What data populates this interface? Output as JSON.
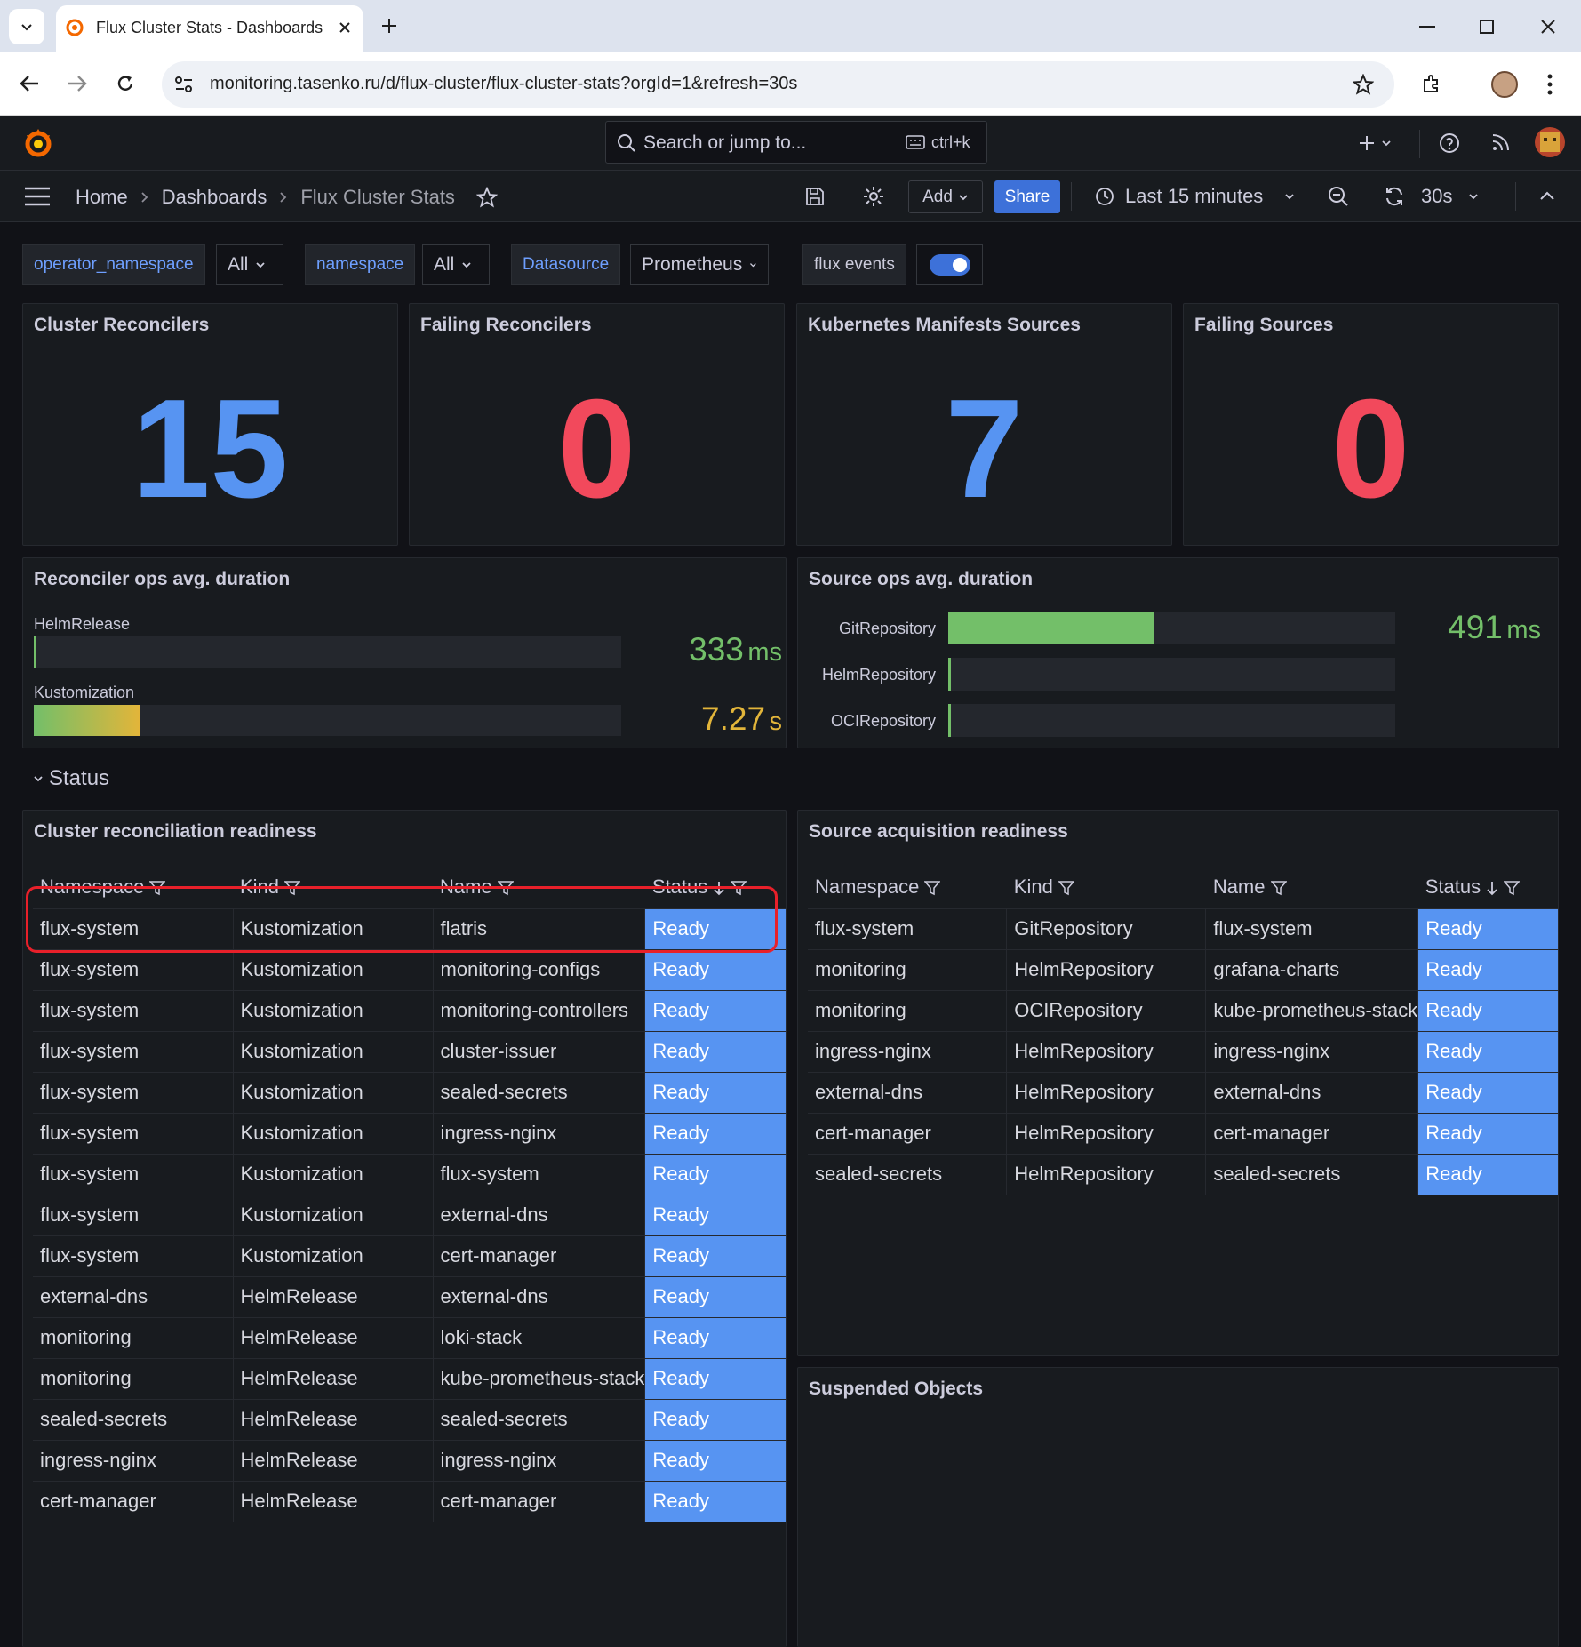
{
  "browser": {
    "tab_title": "Flux Cluster Stats - Dashboards",
    "url": "monitoring.tasenko.ru/d/flux-cluster/flux-cluster-stats?orgId=1&refresh=30s"
  },
  "topbar": {
    "search_placeholder": "Search or jump to...",
    "search_shortcut": "ctrl+k"
  },
  "breadcrumb": {
    "home": "Home",
    "dashboards": "Dashboards",
    "current": "Flux Cluster Stats"
  },
  "toolbar": {
    "add_label": "Add",
    "share_label": "Share",
    "time_range": "Last 15 minutes",
    "refresh_interval": "30s"
  },
  "variables": {
    "operator_namespace": {
      "label": "operator_namespace",
      "value": "All"
    },
    "namespace": {
      "label": "namespace",
      "value": "All"
    },
    "datasource": {
      "label": "Datasource",
      "value": "Prometheus"
    },
    "flux_events": {
      "label": "flux events",
      "enabled": true
    }
  },
  "stats": [
    {
      "title": "Cluster Reconcilers",
      "value": "15",
      "color": "#5794f2"
    },
    {
      "title": "Failing Reconcilers",
      "value": "0",
      "color": "#f2495c"
    },
    {
      "title": "Kubernetes Manifests Sources",
      "value": "7",
      "color": "#5794f2"
    },
    {
      "title": "Failing Sources",
      "value": "0",
      "color": "#f2495c"
    }
  ],
  "reconciler_ops": {
    "title": "Reconciler ops avg. duration",
    "bars": [
      {
        "label": "HelmRelease",
        "value": "333",
        "unit": "ms",
        "fill": 0.004,
        "color": "#73bf69"
      },
      {
        "label": "Kustomization",
        "value": "7.27",
        "unit": "s",
        "fill": 0.18,
        "color": "#e2b53a"
      }
    ]
  },
  "source_ops": {
    "title": "Source ops avg. duration",
    "value": "491",
    "unit": "ms",
    "value_color": "#73bf69",
    "bars": [
      {
        "label": "GitRepository",
        "fill": 0.46
      },
      {
        "label": "HelmRepository",
        "fill": 0.004
      },
      {
        "label": "OCIRepository",
        "fill": 0.004
      }
    ]
  },
  "status_row": {
    "title": "Status"
  },
  "cluster_readiness": {
    "title": "Cluster reconciliation readiness",
    "columns": [
      "Namespace",
      "Kind",
      "Name",
      "Status"
    ],
    "rows": [
      [
        "flux-system",
        "Kustomization",
        "flatris",
        "Ready"
      ],
      [
        "flux-system",
        "Kustomization",
        "monitoring-configs",
        "Ready"
      ],
      [
        "flux-system",
        "Kustomization",
        "monitoring-controllers",
        "Ready"
      ],
      [
        "flux-system",
        "Kustomization",
        "cluster-issuer",
        "Ready"
      ],
      [
        "flux-system",
        "Kustomization",
        "sealed-secrets",
        "Ready"
      ],
      [
        "flux-system",
        "Kustomization",
        "ingress-nginx",
        "Ready"
      ],
      [
        "flux-system",
        "Kustomization",
        "flux-system",
        "Ready"
      ],
      [
        "flux-system",
        "Kustomization",
        "external-dns",
        "Ready"
      ],
      [
        "flux-system",
        "Kustomization",
        "cert-manager",
        "Ready"
      ],
      [
        "external-dns",
        "HelmRelease",
        "external-dns",
        "Ready"
      ],
      [
        "monitoring",
        "HelmRelease",
        "loki-stack",
        "Ready"
      ],
      [
        "monitoring",
        "HelmRelease",
        "kube-prometheus-stack",
        "Ready"
      ],
      [
        "sealed-secrets",
        "HelmRelease",
        "sealed-secrets",
        "Ready"
      ],
      [
        "ingress-nginx",
        "HelmRelease",
        "ingress-nginx",
        "Ready"
      ],
      [
        "cert-manager",
        "HelmRelease",
        "cert-manager",
        "Ready"
      ]
    ]
  },
  "source_readiness": {
    "title": "Source acquisition readiness",
    "columns": [
      "Namespace",
      "Kind",
      "Name",
      "Status"
    ],
    "rows": [
      [
        "flux-system",
        "GitRepository",
        "flux-system",
        "Ready"
      ],
      [
        "monitoring",
        "HelmRepository",
        "grafana-charts",
        "Ready"
      ],
      [
        "monitoring",
        "OCIRepository",
        "kube-prometheus-stack",
        "Ready"
      ],
      [
        "ingress-nginx",
        "HelmRepository",
        "ingress-nginx",
        "Ready"
      ],
      [
        "external-dns",
        "HelmRepository",
        "external-dns",
        "Ready"
      ],
      [
        "cert-manager",
        "HelmRepository",
        "cert-manager",
        "Ready"
      ],
      [
        "sealed-secrets",
        "HelmRepository",
        "sealed-secrets",
        "Ready"
      ]
    ]
  },
  "suspended": {
    "title": "Suspended Objects"
  }
}
